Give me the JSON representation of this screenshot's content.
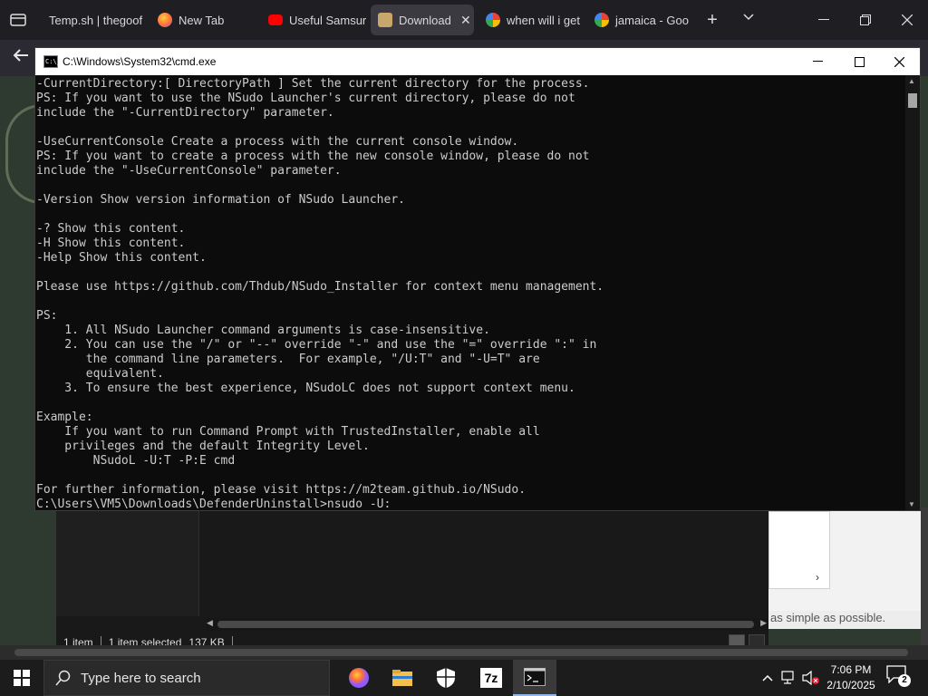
{
  "browser": {
    "tabs": [
      {
        "label": "Temp.sh | thegoof",
        "icon": "website-icon",
        "color": "#1f1f23"
      },
      {
        "label": "New Tab",
        "icon": "firefox-icon",
        "color": "#ff7139"
      },
      {
        "label": "Useful Samsur",
        "icon": "youtube-icon",
        "color": "#ff0000"
      },
      {
        "label": "Download I",
        "icon": "download-page-icon",
        "color": "#c9a66b",
        "active": true
      },
      {
        "label": "when will i get",
        "icon": "google-icon",
        "color": "#4285f4"
      },
      {
        "label": "jamaica - Goo",
        "icon": "google-icon",
        "color": "#4285f4"
      }
    ],
    "new_tab_label": "+",
    "tab_list_label": "⌄"
  },
  "cmd": {
    "title": "C:\\Windows\\System32\\cmd.exe",
    "icon_text": "C:\\_",
    "lines": [
      "-CurrentDirectory:[ DirectoryPath ] Set the current directory for the process.",
      "PS: If you want to use the NSudo Launcher's current directory, please do not",
      "include the \"-CurrentDirectory\" parameter.",
      "",
      "-UseCurrentConsole Create a process with the current console window.",
      "PS: If you want to create a process with the new console window, please do not",
      "include the \"-UseCurrentConsole\" parameter.",
      "",
      "-Version Show version information of NSudo Launcher.",
      "",
      "-? Show this content.",
      "-H Show this content.",
      "-Help Show this content.",
      "",
      "Please use https://github.com/Thdub/NSudo_Installer for context menu management.",
      "",
      "PS:",
      "    1. All NSudo Launcher command arguments is case-insensitive.",
      "    2. You can use the \"/\" or \"--\" override \"-\" and use the \"=\" override \":\" in",
      "       the command line parameters.  For example, \"/U:T\" and \"-U=T\" are",
      "       equivalent.",
      "    3. To ensure the best experience, NSudoLC does not support context menu.",
      "",
      "Example:",
      "    If you want to run Command Prompt with TrustedInstaller, enable all",
      "    privileges and the default Integrity Level.",
      "        NSudoL -U:T -P:E cmd",
      "",
      "For further information, please visit https://m2team.github.io/NSudo.",
      "C:\\Users\\VM5\\Downloads\\DefenderUninstall>nsudo -U:"
    ]
  },
  "explorer": {
    "status_items": "1 item",
    "status_selected": "1 item selected",
    "status_size": "137 KB"
  },
  "background_page": {
    "text": "as simple as possible."
  },
  "taskbar": {
    "search_placeholder": "Type here to search",
    "apps": [
      "firefox-icon",
      "file-explorer-icon",
      "windows-security-icon",
      "7zip-icon",
      "command-prompt-icon"
    ],
    "sevenzip_label": "7z",
    "time": "7:06 PM",
    "date": "2/10/2025",
    "notification_count": "2"
  }
}
